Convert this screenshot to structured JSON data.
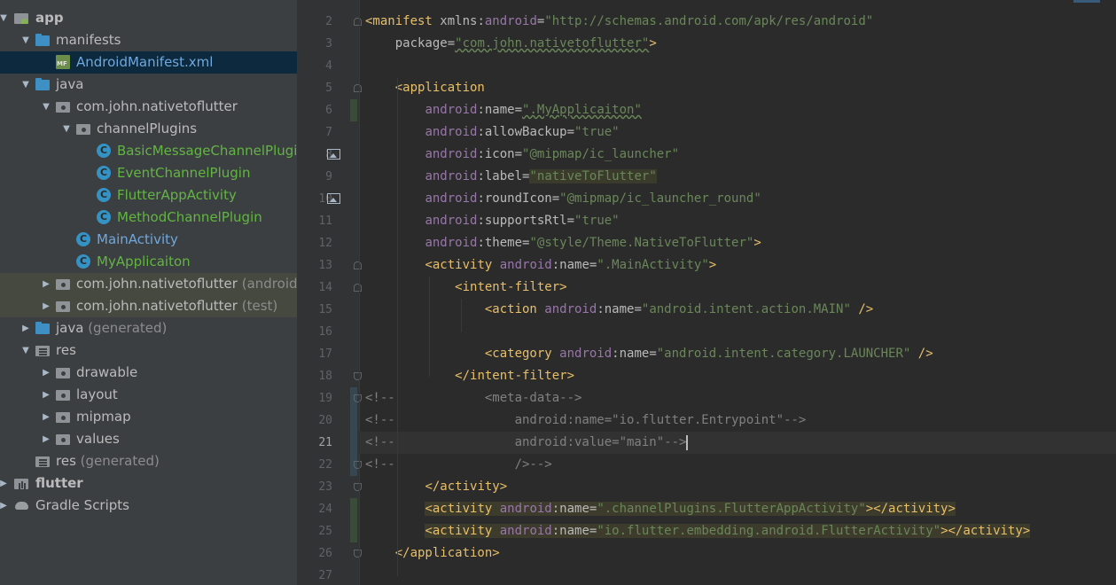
{
  "tree": {
    "rows": [
      {
        "label": "app",
        "suffix": "",
        "icon": "module-app-icon",
        "arrow": "down",
        "indent": 0,
        "style": "bold",
        "state": ""
      },
      {
        "label": "manifests",
        "suffix": "",
        "icon": "folder-blue-icon",
        "arrow": "down",
        "indent": 1,
        "style": "",
        "state": ""
      },
      {
        "label": "AndroidManifest.xml",
        "suffix": "",
        "icon": "manifest-file-icon",
        "arrow": "",
        "indent": 2,
        "style": "blue",
        "state": "sel"
      },
      {
        "label": "java",
        "suffix": "",
        "icon": "folder-blue-icon",
        "arrow": "down",
        "indent": 1,
        "style": "",
        "state": ""
      },
      {
        "label": "com.john.nativetoflutter",
        "suffix": "",
        "icon": "package-folder-icon",
        "arrow": "down",
        "indent": 2,
        "style": "",
        "state": ""
      },
      {
        "label": "channelPlugins",
        "suffix": "",
        "icon": "package-folder-icon",
        "arrow": "down",
        "indent": 3,
        "style": "",
        "state": ""
      },
      {
        "label": "BasicMessageChannelPlugin",
        "suffix": "",
        "icon": "class-icon",
        "arrow": "",
        "indent": 4,
        "style": "green",
        "state": ""
      },
      {
        "label": "EventChannelPlugin",
        "suffix": "",
        "icon": "class-icon",
        "arrow": "",
        "indent": 4,
        "style": "green",
        "state": ""
      },
      {
        "label": "FlutterAppActivity",
        "suffix": "",
        "icon": "class-icon",
        "arrow": "",
        "indent": 4,
        "style": "green",
        "state": ""
      },
      {
        "label": "MethodChannelPlugin",
        "suffix": "",
        "icon": "class-icon",
        "arrow": "",
        "indent": 4,
        "style": "green",
        "state": ""
      },
      {
        "label": "MainActivity",
        "suffix": "",
        "icon": "class-icon",
        "arrow": "",
        "indent": 3,
        "style": "blue",
        "state": ""
      },
      {
        "label": "MyApplicaiton",
        "suffix": "",
        "icon": "class-icon",
        "arrow": "",
        "indent": 3,
        "style": "green",
        "state": ""
      },
      {
        "label": "com.john.nativetoflutter",
        "suffix": " (androidT",
        "icon": "package-folder-icon",
        "arrow": "right",
        "indent": 2,
        "style": "",
        "state": "hl"
      },
      {
        "label": "com.john.nativetoflutter",
        "suffix": " (test)",
        "icon": "package-folder-icon",
        "arrow": "right",
        "indent": 2,
        "style": "",
        "state": "hl"
      },
      {
        "label": "java",
        "suffix": " (generated)",
        "icon": "folder-blue-icon",
        "arrow": "right",
        "indent": 1,
        "style": "",
        "state": ""
      },
      {
        "label": "res",
        "suffix": "",
        "icon": "res-folder-icon",
        "arrow": "down",
        "indent": 1,
        "style": "",
        "state": ""
      },
      {
        "label": "drawable",
        "suffix": "",
        "icon": "package-folder-icon",
        "arrow": "right",
        "indent": 2,
        "style": "",
        "state": ""
      },
      {
        "label": "layout",
        "suffix": "",
        "icon": "package-folder-icon",
        "arrow": "right",
        "indent": 2,
        "style": "",
        "state": ""
      },
      {
        "label": "mipmap",
        "suffix": "",
        "icon": "package-folder-icon",
        "arrow": "right",
        "indent": 2,
        "style": "",
        "state": ""
      },
      {
        "label": "values",
        "suffix": "",
        "icon": "package-folder-icon",
        "arrow": "right",
        "indent": 2,
        "style": "",
        "state": ""
      },
      {
        "label": "res",
        "suffix": " (generated)",
        "icon": "res-folder-icon",
        "arrow": "",
        "indent": 1,
        "style": "",
        "state": ""
      },
      {
        "label": "flutter",
        "suffix": "",
        "icon": "flutter-module-icon",
        "arrow": "right",
        "indent": 0,
        "style": "bold",
        "state": ""
      },
      {
        "label": "Gradle Scripts",
        "suffix": "",
        "icon": "gradle-icon",
        "arrow": "right",
        "indent": 0,
        "style": "",
        "state": ""
      }
    ]
  },
  "editor": {
    "current_line": 21,
    "lines": [
      {
        "n": "2",
        "segs": [
          [
            "t",
            "<manifest "
          ],
          [
            "ak",
            "xmlns:"
          ],
          [
            "an",
            "android"
          ],
          [
            "ak",
            "="
          ],
          [
            "av",
            "\"http://schemas.android.com/apk/res/android\""
          ]
        ]
      },
      {
        "n": "3",
        "segs": [
          [
            "ak",
            "    package="
          ],
          [
            "av",
            "\"com.john.nativetoflutter\""
          ],
          [
            "t",
            ">"
          ]
        ]
      },
      {
        "n": "4",
        "segs": []
      },
      {
        "n": "5",
        "segs": [
          [
            "ak",
            "    "
          ],
          [
            "t",
            "<application"
          ]
        ]
      },
      {
        "n": "6",
        "segs": [
          [
            "ak",
            "        "
          ],
          [
            "an",
            "android"
          ],
          [
            "ak",
            ":name="
          ],
          [
            "av",
            "\".MyApplicaiton\""
          ]
        ]
      },
      {
        "n": "7",
        "segs": [
          [
            "ak",
            "        "
          ],
          [
            "an",
            "android"
          ],
          [
            "ak",
            ":allowBackup="
          ],
          [
            "av",
            "\"true\""
          ]
        ]
      },
      {
        "n": "8",
        "segs": [
          [
            "ak",
            "        "
          ],
          [
            "an",
            "android"
          ],
          [
            "ak",
            ":icon="
          ],
          [
            "av",
            "\"@mipmap/ic_launcher\""
          ]
        ]
      },
      {
        "n": "9",
        "segs": [
          [
            "ak",
            "        "
          ],
          [
            "an",
            "android"
          ],
          [
            "ak",
            ":label="
          ],
          [
            "av",
            "\"nativeToFlutter\""
          ]
        ]
      },
      {
        "n": "10",
        "segs": [
          [
            "ak",
            "        "
          ],
          [
            "an",
            "android"
          ],
          [
            "ak",
            ":roundIcon="
          ],
          [
            "av",
            "\"@mipmap/ic_launcher_round\""
          ]
        ]
      },
      {
        "n": "11",
        "segs": [
          [
            "ak",
            "        "
          ],
          [
            "an",
            "android"
          ],
          [
            "ak",
            ":supportsRtl="
          ],
          [
            "av",
            "\"true\""
          ]
        ]
      },
      {
        "n": "12",
        "segs": [
          [
            "ak",
            "        "
          ],
          [
            "an",
            "android"
          ],
          [
            "ak",
            ":theme="
          ],
          [
            "av",
            "\"@style/Theme.NativeToFlutter\""
          ],
          [
            "t",
            ">"
          ]
        ]
      },
      {
        "n": "13",
        "segs": [
          [
            "ak",
            "        "
          ],
          [
            "t",
            "<activity "
          ],
          [
            "an",
            "android"
          ],
          [
            "ak",
            ":name="
          ],
          [
            "av",
            "\".MainActivity\""
          ],
          [
            "t",
            ">"
          ]
        ]
      },
      {
        "n": "14",
        "segs": [
          [
            "ak",
            "            "
          ],
          [
            "t",
            "<intent-filter>"
          ]
        ]
      },
      {
        "n": "15",
        "segs": [
          [
            "ak",
            "                "
          ],
          [
            "t",
            "<action "
          ],
          [
            "an",
            "android"
          ],
          [
            "ak",
            ":name="
          ],
          [
            "av",
            "\"android.intent.action.MAIN\""
          ],
          [
            "ak",
            " "
          ],
          [
            "t",
            "/>"
          ]
        ]
      },
      {
        "n": "16",
        "segs": []
      },
      {
        "n": "17",
        "segs": [
          [
            "ak",
            "                "
          ],
          [
            "t",
            "<category "
          ],
          [
            "an",
            "android"
          ],
          [
            "ak",
            ":name="
          ],
          [
            "av",
            "\"android.intent.category.LAUNCHER\""
          ],
          [
            "ak",
            " "
          ],
          [
            "t",
            "/>"
          ]
        ]
      },
      {
        "n": "18",
        "segs": [
          [
            "ak",
            "            "
          ],
          [
            "t",
            "</intent-filter>"
          ]
        ]
      },
      {
        "n": "19",
        "segs": [
          [
            "cm",
            "<!--            <meta-data-->"
          ]
        ]
      },
      {
        "n": "20",
        "segs": [
          [
            "cm",
            "<!--                android:name=\"io.flutter.Entrypoint\"-->"
          ]
        ]
      },
      {
        "n": "21",
        "segs": [
          [
            "cm",
            "<!--                android:value=\"main\"-->"
          ]
        ]
      },
      {
        "n": "22",
        "segs": [
          [
            "cm",
            "<!--                />-->"
          ]
        ]
      },
      {
        "n": "23",
        "segs": [
          [
            "ak",
            "        "
          ],
          [
            "t",
            "</activity>"
          ]
        ]
      },
      {
        "n": "24",
        "segs": [
          [
            "ak",
            "        "
          ],
          [
            "t",
            "<activity "
          ],
          [
            "an",
            "android"
          ],
          [
            "ak",
            ":name="
          ],
          [
            "av",
            "\".channelPlugins.FlutterAppActivity\""
          ],
          [
            "t",
            "></activity>"
          ]
        ]
      },
      {
        "n": "25",
        "segs": [
          [
            "ak",
            "        "
          ],
          [
            "t",
            "<activity "
          ],
          [
            "an",
            "android"
          ],
          [
            "ak",
            ":name="
          ],
          [
            "av",
            "\"io.flutter.embedding.android.FlutterActivity\""
          ],
          [
            "t",
            "></activity>"
          ]
        ]
      },
      {
        "n": "26",
        "segs": [
          [
            "ak",
            "    "
          ],
          [
            "t",
            "</application>"
          ]
        ]
      },
      {
        "n": "27",
        "segs": []
      }
    ]
  },
  "colors": {
    "tree_bg": "#3c3f41",
    "editor_bg": "#2b2b2b",
    "tag": "#e8bf6a",
    "attr_ns": "#9876aa",
    "value": "#6a8759",
    "comment": "#808080"
  }
}
